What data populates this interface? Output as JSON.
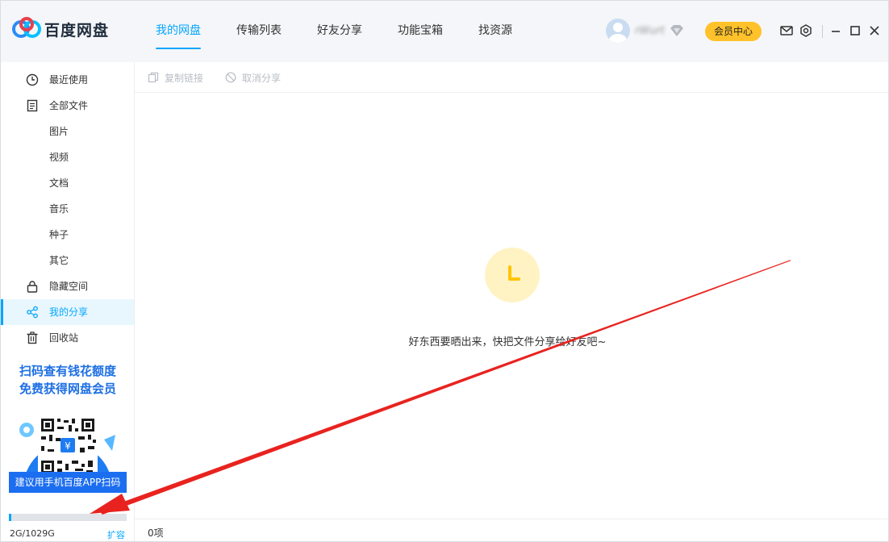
{
  "app": {
    "name": "百度网盘"
  },
  "nav": {
    "tabs": [
      {
        "label": "我的网盘",
        "active": true
      },
      {
        "label": "传输列表",
        "active": false
      },
      {
        "label": "好友分享",
        "active": false
      },
      {
        "label": "功能宝箱",
        "active": false
      },
      {
        "label": "找资源",
        "active": false
      }
    ]
  },
  "user": {
    "name": "rWurt",
    "vip_button": "会员中心"
  },
  "sidebar": {
    "items": [
      {
        "label": "最近使用",
        "icon": "clock-icon"
      },
      {
        "label": "全部文件",
        "icon": "file-icon"
      },
      {
        "label": "图片"
      },
      {
        "label": "视频"
      },
      {
        "label": "文档"
      },
      {
        "label": "音乐"
      },
      {
        "label": "种子"
      },
      {
        "label": "其它"
      },
      {
        "label": "隐藏空间",
        "icon": "lock-icon"
      },
      {
        "label": "我的分享",
        "icon": "share-icon",
        "active": true
      },
      {
        "label": "回收站",
        "icon": "trash-icon"
      }
    ]
  },
  "promo": {
    "line1": "扫码查有钱花额度",
    "line2": "免费获得网盘会员",
    "button": "建议用手机百度APP扫码"
  },
  "quota": {
    "text": "2G/1029G",
    "expand": "扩容",
    "used_fraction": 0.002
  },
  "toolbar": {
    "copy_link": "复制链接",
    "cancel_share": "取消分享"
  },
  "main": {
    "empty_text": "好东西要晒出来，快把文件分享给好友吧~",
    "item_count": "0项"
  },
  "colors": {
    "accent": "#06a7ff",
    "vip": "#ffc22a",
    "annotation_arrow": "#e8231f"
  }
}
